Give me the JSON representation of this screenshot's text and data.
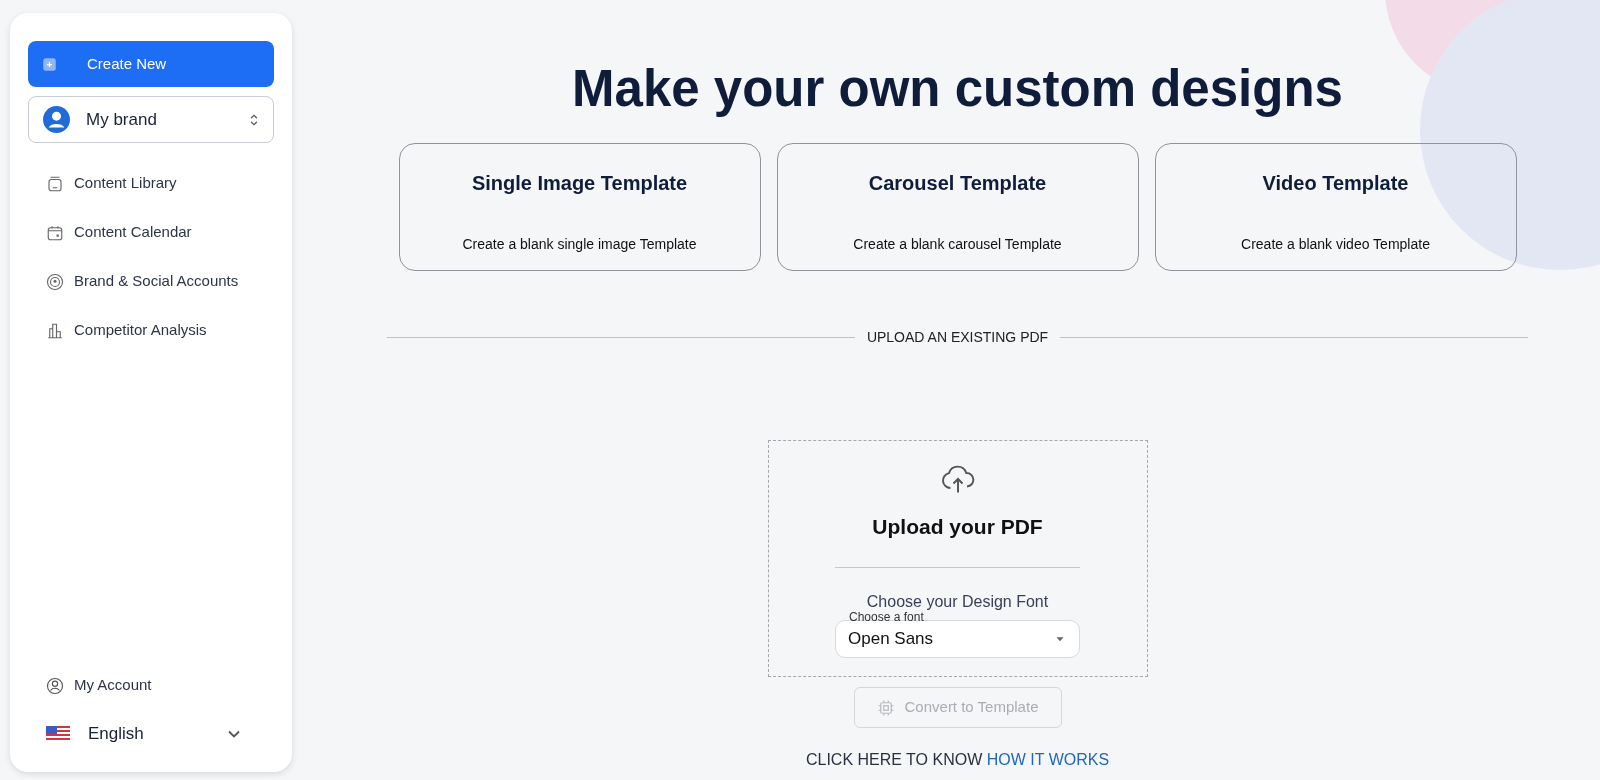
{
  "sidebar": {
    "create_button": {
      "label": "Create New"
    },
    "brand_select": {
      "value": "My brand"
    },
    "items": [
      {
        "label": "Content Library",
        "kind": "library"
      },
      {
        "label": "Content Calendar",
        "kind": "calendar"
      },
      {
        "label": "Brand & Social Accounts",
        "kind": "broadcast"
      },
      {
        "label": "Competitor Analysis",
        "kind": "chart"
      }
    ],
    "footer_items": [
      {
        "label": "My Account",
        "kind": "account"
      }
    ],
    "language": {
      "value": "English"
    }
  },
  "main": {
    "heading": "Make your own custom designs",
    "templates": [
      {
        "title": "Single Image Template",
        "description": "Create a blank single image Template"
      },
      {
        "title": "Carousel Template",
        "description": "Create a blank carousel Template"
      },
      {
        "title": "Video Template",
        "description": "Create a blank video Template"
      }
    ],
    "divider_label": "UPLOAD AN EXISTING PDF",
    "upload": {
      "title": "Upload your PDF",
      "font_prompt": "Choose your Design Font",
      "font_select": {
        "label": "Choose a font",
        "value": "Open Sans"
      }
    },
    "convert_button": {
      "label": "Convert to Template",
      "disabled": true
    },
    "help": {
      "text": "CLICK HERE TO KNOW",
      "link": "HOW IT WORKS"
    }
  }
}
